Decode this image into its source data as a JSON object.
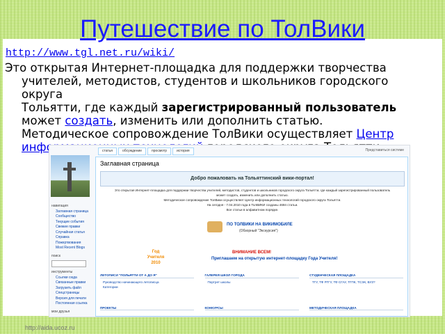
{
  "slide": {
    "title": "Путешествие по ТолВики",
    "url": "http://www.tgl.net.ru/wiki/",
    "para": {
      "line1": "Это открытая Интернет-площадка для поддержки творчества",
      "line2": "учителей, методистов, студентов и школьников городского округа",
      "line3_a": "Тольятти, где каждый ",
      "line3_b": "зарегистрированный пользователь",
      "line4_a": "может ",
      "line4_link": "создать",
      "line4_b": ", изменить или дополнить статью.",
      "line5_a": "Методическое сопровождение ТолВики осуществляет ",
      "line5_link": "Центр",
      "line6_link": "информационных технологий",
      "line6_b": " городского округа Тольятти."
    },
    "footer_url": "http://aida.ucoz.ru"
  },
  "wiki": {
    "tabs": [
      "статья",
      "обсуждение",
      "просмотр",
      "история"
    ],
    "toplinks": "Представиться системе",
    "page_title": "Заглавная страница",
    "welcome": "Добро пожаловать на Тольяттинский вики-портал!",
    "intro1": "Это открытая Интернет-площадка для поддержки творчества учителей, методистов, студентов и школьников городского округа Тольятти, где каждый зарегистрированный пользователь",
    "intro2": "может создать, изменить или дополнить статью.",
    "intro3": "Методическое сопровождение ТолВики осуществляет Центр информационных технологий городского округа Тольятти.",
    "intro4": "На сегодня - 7.04.2010 года в ТолВИКИ созданы 4694 статьи.",
    "intro5": "Все статьи в алфавитном порядке.",
    "mobile_title": "ПО ТОЛВИКИ НА ВИКИМОБИЛЕ",
    "mobile_sub": "(Обзорный \"Экскурсия\")",
    "year_label": "Год Учителя 2010",
    "attention": "ВНИМАНИЕ ВСЕМ!",
    "invite": "Приглашаем на открытую интернет-площадку Года Учителя!",
    "side": {
      "nav_head": "навигация",
      "nav": [
        "Заглавная страница",
        "Сообщество",
        "Текущие события",
        "Свежие правки",
        "Случайная статья",
        "Справка",
        "Пожертвования",
        "Most Recent Blogs"
      ],
      "search_head": "поиск",
      "tools_head": "инструменты",
      "tools": [
        "Ссылки сюда",
        "Связанные правки",
        "Загрузить файл",
        "Спецстраницы",
        "Версия для печати",
        "Постоянная ссылка"
      ],
      "lang_head": "мои друзья"
    },
    "cols": [
      {
        "head": "ЛЕТОПИСИ \"ПОЛЬЯТТИ ОТ А ДО Я\"",
        "items": [
          "Руководство начинающего летописца",
          "Категории"
        ]
      },
      {
        "head": "ГАЛЕРЕЯ ШКОЛ ГОРОДА",
        "items": [
          "Портрет школы"
        ]
      },
      {
        "head": "СТУДЕНЧЕСКАЯ ПЛОЩАДКА",
        "items": [
          "ТГУ, ТФ РГГУ, ТФ СГАУ, ТГПК, ТСЭК, ВУЗ?"
        ]
      }
    ],
    "row2": [
      "ПРОЕКТЫ",
      "КОНКУРСЫ",
      "МЕТОДИЧЕСКАЯ ПЛОЩАДКА"
    ]
  }
}
